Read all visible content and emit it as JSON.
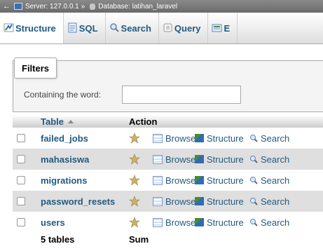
{
  "breadcrumb": {
    "back": "←",
    "server": "Server: 127.0.0.1",
    "separator": "»",
    "database": "Database: latihan_laravel"
  },
  "tabs": [
    {
      "label": "Structure",
      "icon": "structure-icon",
      "active": true
    },
    {
      "label": "SQL",
      "icon": "sql-icon",
      "active": false
    },
    {
      "label": "Search",
      "icon": "search-icon",
      "active": false
    },
    {
      "label": "Query",
      "icon": "query-icon",
      "active": false
    },
    {
      "label": "E",
      "icon": "export-icon",
      "active": false
    }
  ],
  "filters": {
    "legend": "Filters",
    "label": "Containing the word:",
    "value": ""
  },
  "table": {
    "headers": {
      "table": "Table",
      "action": "Action"
    },
    "rows": [
      {
        "name": "failed_jobs"
      },
      {
        "name": "mahasiswa"
      },
      {
        "name": "migrations"
      },
      {
        "name": "password_resets"
      },
      {
        "name": "users"
      }
    ],
    "actions": {
      "browse": "Browse",
      "structure": "Structure",
      "search": "Search"
    },
    "footer": {
      "count": "5 tables",
      "sum": "Sum"
    }
  },
  "colors": {
    "link": "#235a81",
    "row_alt": "#dfdfdf",
    "star": "#c8b26a"
  }
}
